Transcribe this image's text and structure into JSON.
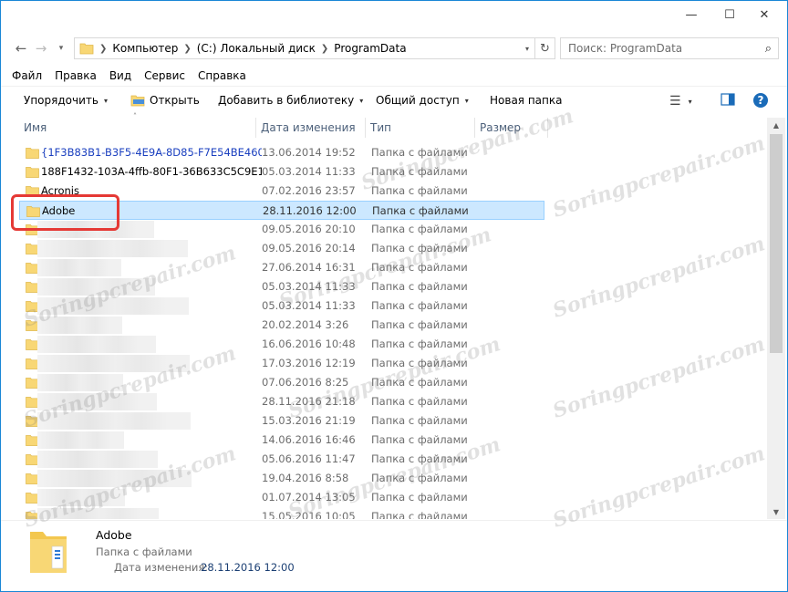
{
  "window": {
    "controls": {
      "minimize": "—",
      "maximize": "☐",
      "close": "✕"
    }
  },
  "address": {
    "crumbs": [
      "Компьютер",
      "(C:) Локальный диск",
      "ProgramData"
    ],
    "search_placeholder": "Поиск: ProgramData"
  },
  "menu": [
    "Файл",
    "Правка",
    "Вид",
    "Сервис",
    "Справка"
  ],
  "toolbar": {
    "organize": "Упорядочить",
    "open": "Открыть",
    "add_library": "Добавить в библиотеку",
    "share": "Общий доступ",
    "new_folder": "Новая папка"
  },
  "columns": {
    "name": "Имя",
    "date": "Дата изменения",
    "type": "Тип",
    "size": "Размер"
  },
  "files": [
    {
      "name": "{1F3B83B1-B3F5-4E9A-8D85-F7E54BE460...",
      "date": "13.06.2014 19:52",
      "type": "Папка с файлами",
      "encrypted": true
    },
    {
      "name": "188F1432-103A-4ffb-80F1-36B633C5C9E1",
      "date": "05.03.2014 11:33",
      "type": "Папка с файлами"
    },
    {
      "name": "Acronis",
      "date": "07.02.2016 23:57",
      "type": "Папка с файлами"
    },
    {
      "name": "Adobe",
      "date": "28.11.2016 12:00",
      "type": "Папка с файлами",
      "selected": true
    },
    {
      "name": "",
      "date": "09.05.2016 20:10",
      "type": "Папка с файлами"
    },
    {
      "name": "",
      "date": "09.05.2016 20:14",
      "type": "Папка с файлами"
    },
    {
      "name": "",
      "date": "27.06.2014 16:31",
      "type": "Папка с файлами"
    },
    {
      "name": "",
      "date": "05.03.2014 11:33",
      "type": "Папка с файлами"
    },
    {
      "name": "",
      "date": "05.03.2014 11:33",
      "type": "Папка с файлами"
    },
    {
      "name": "",
      "date": "20.02.2014 3:26",
      "type": "Папка с файлами"
    },
    {
      "name": "",
      "date": "16.06.2016 10:48",
      "type": "Папка с файлами"
    },
    {
      "name": "",
      "date": "17.03.2016 12:19",
      "type": "Папка с файлами"
    },
    {
      "name": "",
      "date": "07.06.2016 8:25",
      "type": "Папка с файлами"
    },
    {
      "name": "",
      "date": "28.11.2016 21:18",
      "type": "Папка с файлами"
    },
    {
      "name": "",
      "date": "15.03.2016 21:19",
      "type": "Папка с файлами"
    },
    {
      "name": "",
      "date": "14.06.2016 16:46",
      "type": "Папка с файлами"
    },
    {
      "name": "",
      "date": "05.06.2016 11:47",
      "type": "Папка с файлами"
    },
    {
      "name": "",
      "date": "19.04.2016 8:58",
      "type": "Папка с файлами"
    },
    {
      "name": "",
      "date": "01.07.2014 13:05",
      "type": "Папка с файлами"
    },
    {
      "name": "",
      "date": "15.05.2016 10:05",
      "type": "Папка с файлами"
    }
  ],
  "details": {
    "name": "Adobe",
    "type": "Папка с файлами",
    "date_label": "Дата изменения:",
    "date_value": "28.11.2016 12:00"
  },
  "colors": {
    "accent": "#1a87d6",
    "selection": "#cce8ff",
    "highlight_frame": "#e53935",
    "encrypted_text": "#1a3fbf"
  }
}
